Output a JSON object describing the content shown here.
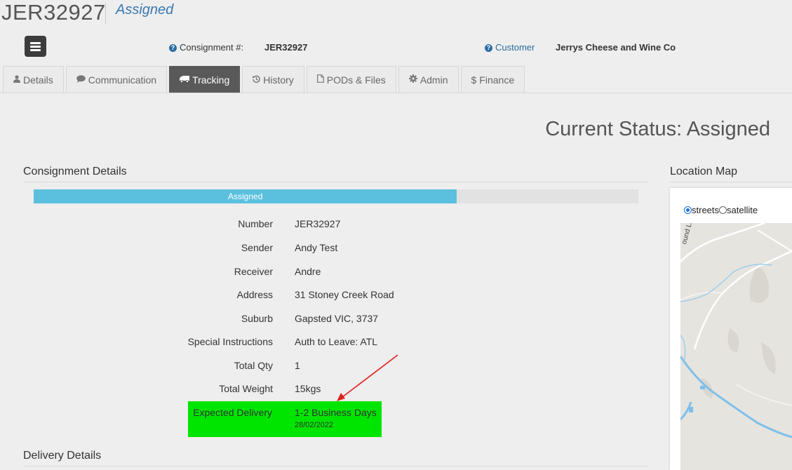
{
  "header": {
    "consignment_id": "JER32927",
    "status": "Assigned",
    "consignment_label": "Consignment #:",
    "consignment_value": "JER32927",
    "customer_label": "Customer",
    "customer_value": "Jerrys Cheese and Wine Co"
  },
  "tabs": [
    {
      "label": "Details",
      "icon": "user-icon"
    },
    {
      "label": "Communication",
      "icon": "comment-icon"
    },
    {
      "label": "Tracking",
      "icon": "truck-icon",
      "active": true
    },
    {
      "label": "History",
      "icon": "history-icon"
    },
    {
      "label": "PODs & Files",
      "icon": "file-icon"
    },
    {
      "label": "Admin",
      "icon": "gear-icon"
    },
    {
      "label": "Finance",
      "icon": "dollar-icon"
    }
  ],
  "current_status": "Current Status: Assigned",
  "consignment_details": {
    "title": "Consignment Details",
    "progress_label": "Assigned",
    "progress_fraction": 0.7,
    "rows": [
      {
        "label": "Number",
        "value": "JER32927"
      },
      {
        "label": "Sender",
        "value": "Andy Test"
      },
      {
        "label": "Receiver",
        "value": "Andre"
      },
      {
        "label": "Address",
        "value": "31 Stoney Creek Road"
      },
      {
        "label": "Suburb",
        "value": "Gapsted VIC, 3737"
      },
      {
        "label": "Special Instructions",
        "value": "Auth to Leave: ATL"
      },
      {
        "label": "Total Qty",
        "value": "1"
      },
      {
        "label": "Total Weight",
        "value": "15kgs"
      }
    ],
    "expected_delivery": {
      "label": "Expected Delivery",
      "value": "1-2 Business Days",
      "date": "28/02/2022"
    },
    "highlight_color": "#00e500",
    "arrow_color": "#e02020"
  },
  "delivery_details": {
    "title": "Delivery Details"
  },
  "location_map": {
    "title": "Location Map",
    "option_streets": "streets",
    "option_satellite": "satellite",
    "road_label": "ound Ln"
  }
}
